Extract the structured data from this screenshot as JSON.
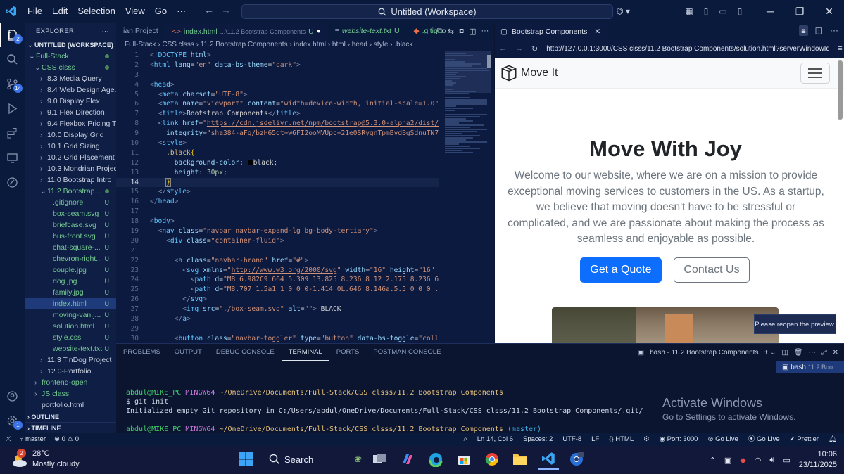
{
  "titlebar": {
    "menu": [
      "File",
      "Edit",
      "Selection",
      "View",
      "Go",
      "···"
    ],
    "search": "Untitled (Workspace)"
  },
  "activity_badges": {
    "explorer": "2",
    "source_control": "14"
  },
  "sidebar": {
    "header": "EXPLORER",
    "workspace": "UNTITLED (WORKSPACE)",
    "tree": [
      {
        "label": "Full-Stack",
        "indent": 1,
        "type": "folder-open",
        "status": "dot"
      },
      {
        "label": "CSS clsss",
        "indent": 2,
        "type": "folder-open",
        "status": "dot"
      },
      {
        "label": "8.3 Media Query",
        "indent": 3,
        "type": "folder",
        "status": ""
      },
      {
        "label": "8.4 Web Design Age...",
        "indent": 3,
        "type": "folder",
        "status": ""
      },
      {
        "label": "9.0 Display Flex",
        "indent": 3,
        "type": "folder",
        "status": ""
      },
      {
        "label": "9.1 Flex Direction",
        "indent": 3,
        "type": "folder",
        "status": ""
      },
      {
        "label": "9.4 Flexbox Pricing T...",
        "indent": 3,
        "type": "folder",
        "status": ""
      },
      {
        "label": "10.0 Display Grid",
        "indent": 3,
        "type": "folder",
        "status": ""
      },
      {
        "label": "10.1 Grid Sizing",
        "indent": 3,
        "type": "folder",
        "status": ""
      },
      {
        "label": "10.2 Grid Placement",
        "indent": 3,
        "type": "folder",
        "status": ""
      },
      {
        "label": "10.3 Mondrian Project",
        "indent": 3,
        "type": "folder",
        "status": ""
      },
      {
        "label": "11.0 Bootstrap Intro",
        "indent": 3,
        "type": "folder",
        "status": ""
      },
      {
        "label": "11.2 Bootstrap...",
        "indent": 3,
        "type": "folder-open",
        "status": "dot",
        "green": true
      },
      {
        "label": ".gitignore",
        "indent": 4,
        "type": "file",
        "status": "U",
        "green": true
      },
      {
        "label": "box-seam.svg",
        "indent": 4,
        "type": "file",
        "status": "U",
        "green": true
      },
      {
        "label": "briefcase.svg",
        "indent": 4,
        "type": "file",
        "status": "U",
        "green": true
      },
      {
        "label": "bus-front.svg",
        "indent": 4,
        "type": "file",
        "status": "U",
        "green": true
      },
      {
        "label": "chat-square-...",
        "indent": 4,
        "type": "file",
        "status": "U",
        "green": true
      },
      {
        "label": "chevron-right...",
        "indent": 4,
        "type": "file",
        "status": "U",
        "green": true
      },
      {
        "label": "couple.jpg",
        "indent": 4,
        "type": "file",
        "status": "U",
        "green": true
      },
      {
        "label": "dog.jpg",
        "indent": 4,
        "type": "file",
        "status": "U",
        "green": true
      },
      {
        "label": "family.jpg",
        "indent": 4,
        "type": "file",
        "status": "U",
        "green": true
      },
      {
        "label": "index.html",
        "indent": 4,
        "type": "file",
        "status": "U",
        "green": true,
        "selected": true
      },
      {
        "label": "moving-van.j...",
        "indent": 4,
        "type": "file",
        "status": "U",
        "green": true
      },
      {
        "label": "solution.html",
        "indent": 4,
        "type": "file",
        "status": "U",
        "green": true
      },
      {
        "label": "style.css",
        "indent": 4,
        "type": "file",
        "status": "U",
        "green": true
      },
      {
        "label": "website-text.txt",
        "indent": 4,
        "type": "file",
        "status": "U",
        "green": true
      },
      {
        "label": "11.3 TinDog Project",
        "indent": 3,
        "type": "folder",
        "status": ""
      },
      {
        "label": "12.0-Portfolio",
        "indent": 3,
        "type": "folder",
        "status": ""
      },
      {
        "label": "frontend-open",
        "indent": 2,
        "type": "folder",
        "status": ""
      },
      {
        "label": "JS class",
        "indent": 2,
        "type": "folder",
        "status": ""
      },
      {
        "label": "portfolio.html",
        "indent": 2,
        "type": "file",
        "status": ""
      }
    ],
    "outline": "OUTLINE",
    "timeline": "TIMELINE"
  },
  "editor": {
    "tabs": [
      {
        "label": "ian Project",
        "state": "",
        "active": false
      },
      {
        "label": "index.html",
        "hint": "...\\11.2 Bootstrap Components",
        "state": "U",
        "active": true,
        "dirty": true
      },
      {
        "label": "website-text.txt",
        "state": "U",
        "active": false
      },
      {
        "label": ".gitigno",
        "state": "",
        "active": false
      }
    ],
    "breadcrumb": "Full-Stack  ›  CSS clsss  ›  11.2 Bootstrap Components  ›  index.html  ›  html  ›  head  ›  style  ›  .black",
    "current_line": 14
  },
  "preview": {
    "tab_title": "Bootstrap Components",
    "url": "http://127.0.0.1:3000/CSS clsss/11.2 Bootstrap Components/solution.html?serverWindowId=",
    "brand": "Move It",
    "heading": "Move With Joy",
    "paragraph": "Welcome to our website, where we are on a mission to provide exceptional moving services to customers in the US. As a startup, we believe that moving doesn't have to be stressful or complicated, and we are passionate about making the process as seamless and enjoyable as possible.",
    "primary_button": "Get a Quote",
    "secondary_button": "Contact Us",
    "tooltip": "Please reopen the preview."
  },
  "panel": {
    "tabs": [
      "PROBLEMS",
      "OUTPUT",
      "DEBUG CONSOLE",
      "TERMINAL",
      "PORTS",
      "POSTMAN CONSOLE"
    ],
    "active_tab": "TERMINAL",
    "terminal_name": "bash - 11.2 Bootstrap Components",
    "side_item": "bash",
    "side_hint": "11.2 Boo",
    "lines": {
      "prompt1_user": "abdul@MIKE_PC",
      "prompt1_env": "MINGW64",
      "prompt1_path": "~/OneDrive/Documents/Full-Stack/CSS clsss/11.2 Bootstrap Components",
      "cmd": "$ git init",
      "output": "Initialized empty Git repository in C:/Users/abdul/OneDrive/Documents/Full-Stack/CSS clsss/11.2 Bootstrap Components/.git/",
      "prompt2_user": "abdul@MIKE_PC",
      "prompt2_env": "MINGW64",
      "prompt2_path": "~/OneDrive/Documents/Full-Stack/CSS clsss/11.2 Bootstrap Components",
      "branch": "(master)",
      "prompt2": "$"
    },
    "watermark_title": "Activate Windows",
    "watermark_sub": "Go to Settings to activate Windows."
  },
  "statusbar": {
    "branch": "master",
    "errors": "0",
    "warnings": "0",
    "position": "Ln 14, Col 6",
    "spaces": "Spaces: 2",
    "encoding": "UTF-8",
    "eol": "LF",
    "language": "HTML",
    "port": "Port: 3000",
    "golive1": "Go Live",
    "golive2": "Go Live",
    "prettier": "Prettier"
  },
  "taskbar": {
    "weather_badge": "2",
    "temp": "28°C",
    "condition": "Mostly cloudy",
    "search": "Search",
    "time": "10:06",
    "date": "23/11/2025"
  },
  "colors": {
    "accent": "#4c88ff",
    "bootstrap_primary": "#0d6efd",
    "git_untracked": "#73c991"
  }
}
